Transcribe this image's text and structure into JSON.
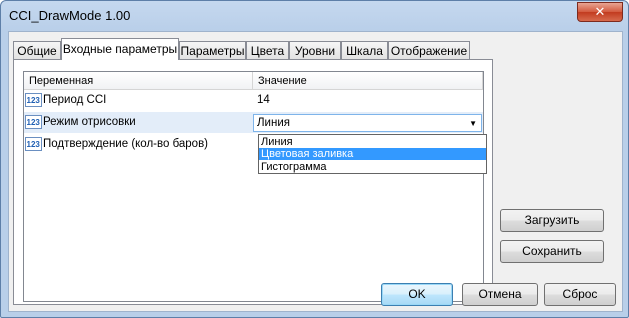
{
  "window": {
    "title": "CCI_DrawMode 1.00",
    "close_glyph": "✕"
  },
  "tabs": [
    "Общие",
    "Входные параметры",
    "Параметры",
    "Цвета",
    "Уровни",
    "Шкала",
    "Отображение"
  ],
  "active_tab": "Входные параметры",
  "grid": {
    "headers": {
      "variable": "Переменная",
      "value": "Значение"
    },
    "rows": [
      {
        "icon": "123-icon",
        "name": "Период CCI",
        "value": "14"
      },
      {
        "icon": "123-icon",
        "name": "Режим отрисовки",
        "value": "Линия"
      },
      {
        "icon": "123-icon",
        "name": "Подтверждение (кол-во баров)",
        "value": ""
      }
    ],
    "dropdown_options": [
      "Линия",
      "Цветовая заливка",
      "Гистограмма"
    ],
    "dropdown_selected": "Цветовая заливка"
  },
  "buttons": {
    "load": "Загрузить",
    "save": "Сохранить",
    "ok": "OK",
    "cancel": "Отмена",
    "reset": "Сброс"
  },
  "colors": {
    "selection": "#3399ff",
    "focus_border": "#7eb4ea",
    "close": "#c23b1f"
  }
}
